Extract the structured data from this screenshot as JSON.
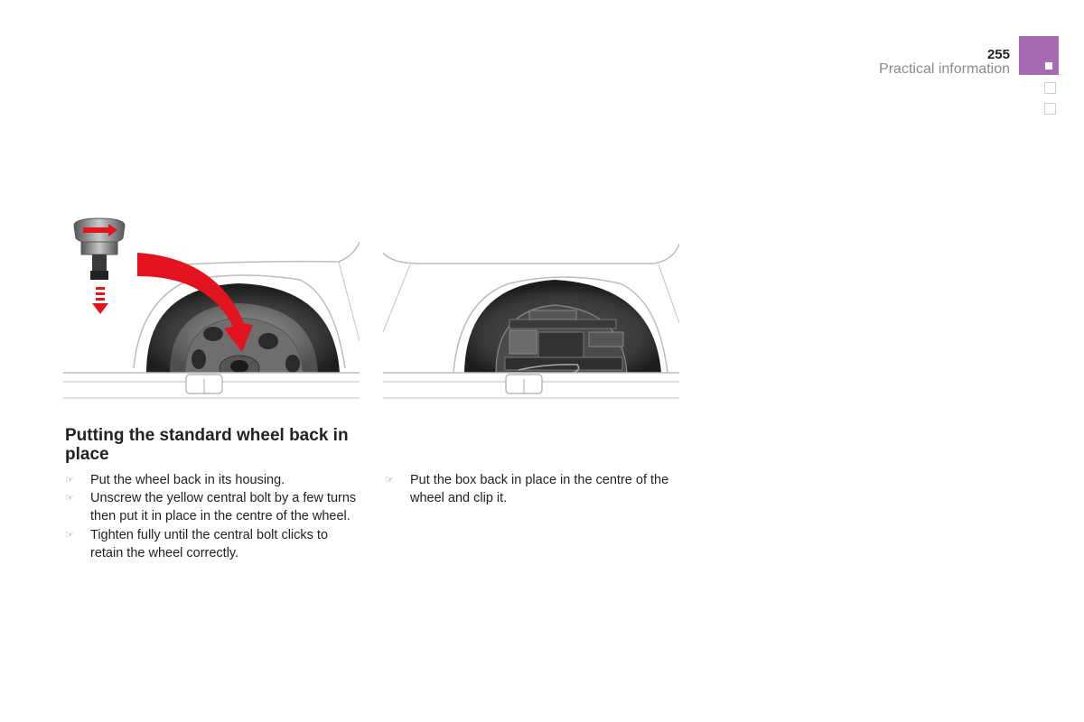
{
  "header": {
    "page_number": "255",
    "section_title": "Practical information",
    "accent_color": "#a76bb1"
  },
  "illustrations": [
    {
      "name": "illustration-wheel-refit",
      "description": "Spare wheel in housing with red arrow guiding central bolt to wheel centre"
    },
    {
      "name": "illustration-box-refit",
      "description": "Wheel housing with tool box placed in wheel centre"
    }
  ],
  "left_column": {
    "heading": "Putting the standard wheel back in place",
    "bullet_icon": "pointing-hand-icon",
    "bullet_glyph": "☞",
    "steps": [
      "Put the wheel back in its housing.",
      "Unscrew the yellow central bolt by a few turns then put it in place in the centre of the wheel.",
      "Tighten fully until the central bolt clicks to retain the wheel correctly."
    ]
  },
  "right_column": {
    "bullet_glyph": "☞",
    "steps": [
      "Put the box back in place in the centre of the wheel and clip it."
    ]
  }
}
